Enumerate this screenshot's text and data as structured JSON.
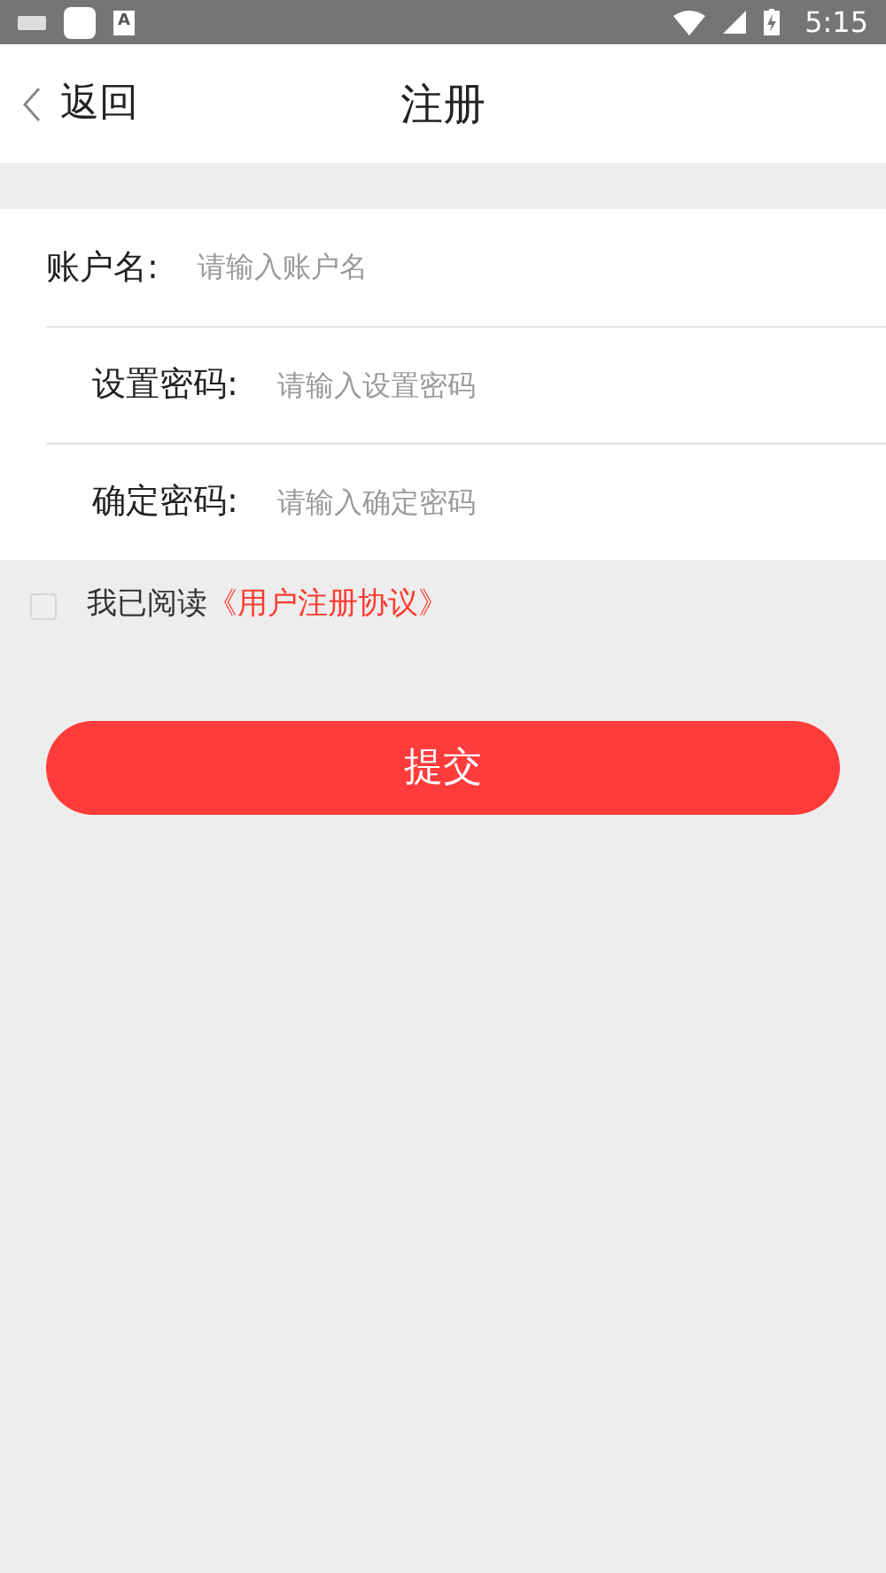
{
  "status_bar": {
    "notification_letter": "A",
    "time": "5:15"
  },
  "header": {
    "back": "返回",
    "title": "注册"
  },
  "fields": [
    {
      "label": "账户名:",
      "placeholder": "请输入账户名"
    },
    {
      "label": "设置密码:",
      "placeholder": "请输入设置密码"
    },
    {
      "label": "确定密码:",
      "placeholder": "请输入确定密码"
    }
  ],
  "agreement": {
    "checked": false,
    "text": "我已阅读",
    "link": "《用户注册协议》"
  },
  "submit": "提交"
}
